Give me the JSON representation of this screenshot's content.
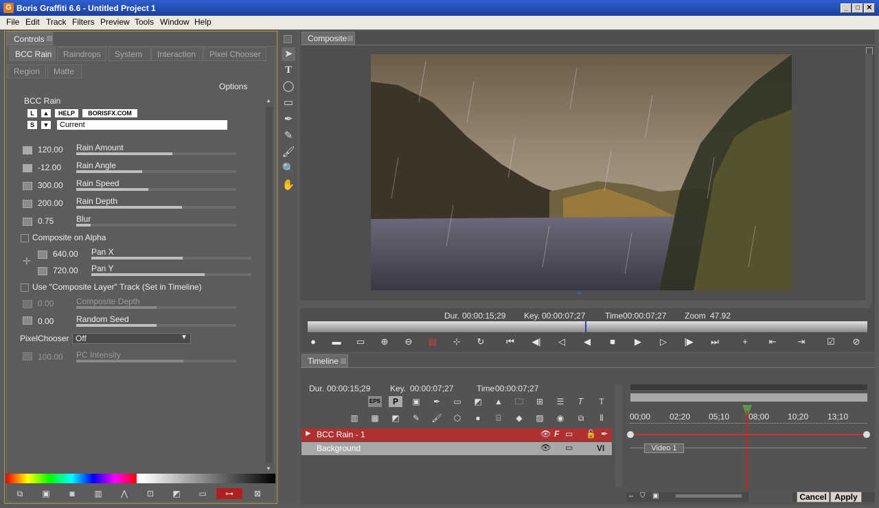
{
  "window": {
    "title": "Boris Graffiti 6.6 - Untitled Project 1",
    "app_icon": "G"
  },
  "menu": [
    "File",
    "Edit",
    "Track",
    "Filters",
    "Preview",
    "Tools",
    "Window",
    "Help"
  ],
  "controls": {
    "panel_tab": "Controls",
    "tabs": [
      "BCC Rain",
      "Raindrops",
      "System",
      "Interaction",
      "Pixel Chooser"
    ],
    "tabs2": [
      "Region",
      "Matte"
    ],
    "options_label": "Options",
    "effect_name": "BCC Rain",
    "btn_l": "L",
    "btn_s": "S",
    "btn_help": "HELP",
    "btn_borisfx": "BORISFX.COM",
    "preset_value": "Current",
    "params": [
      {
        "value": "120.00",
        "label": "Rain Amount",
        "fill": 0.6
      },
      {
        "value": "-12.00",
        "label": "Rain Angle",
        "fill": 0.4
      },
      {
        "value": "300.00",
        "label": "Rain Speed",
        "fill": 0.45
      },
      {
        "value": "200.00",
        "label": "Rain Depth",
        "fill": 0.66
      },
      {
        "value": "0.75",
        "label": "Blur",
        "fill": 0.09
      }
    ],
    "composite_alpha": "Composite on Alpha",
    "pan_x": {
      "value": "640.00",
      "label": "Pan X",
      "fill": 0.57
    },
    "pan_y": {
      "value": "720.00",
      "label": "Pan Y",
      "fill": 0.71
    },
    "composite_layer": "Use \"Composite Layer\" Track (Set in Timeline)",
    "composite_depth": {
      "value": "0.00",
      "label": "Composite Depth",
      "fill": 0.5
    },
    "random_seed": {
      "value": "0.00",
      "label": "Random Seed",
      "fill": 0.5
    },
    "pixelchooser_label": "PixelChooser",
    "pixelchooser_value": "Off",
    "pc_intensity": {
      "value": "100.00",
      "label": "PC Intensity",
      "fill": 0.67
    }
  },
  "composite": {
    "tab": "Composite",
    "dur_label": "Dur.",
    "dur": "00:00:15;29",
    "key_label": "Key.",
    "key": "00:00:07;27",
    "time_label": "Time",
    "time": "00:00:07;27",
    "zoom_label": "Zoom",
    "zoom": "47.92"
  },
  "timeline": {
    "tab": "Timeline",
    "dur_label": "Dur.",
    "dur": "00:00:15;29",
    "key_label": "Key.",
    "key": "00:00:07;27",
    "time_label": "Time",
    "time": "00:00:07;27",
    "ruler": [
      "00;00",
      "02;20",
      "05;10",
      "08;00",
      "10;20",
      "13;10"
    ],
    "tracks": [
      {
        "name": "BCC Rain - 1",
        "color": "#b03030"
      },
      {
        "name": "Background",
        "color": "#a8a8a8"
      }
    ],
    "video_label": "Video 1",
    "btn_eps": "EPS",
    "btn_p": "P",
    "cancel": "Cancel",
    "apply": "Apply",
    "vi_label": "VI"
  }
}
